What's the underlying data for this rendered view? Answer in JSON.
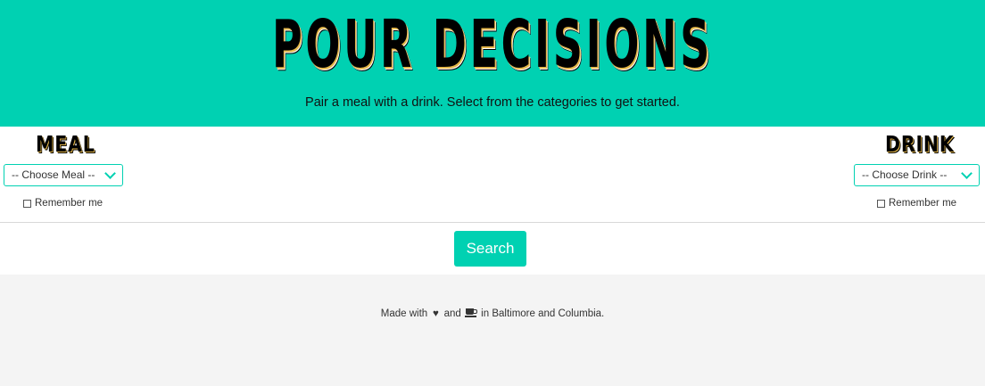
{
  "header": {
    "logo_text": "POUR DECISIONS",
    "tagline": "Pair a meal with a drink. Select from the categories to get started."
  },
  "meal": {
    "title": "MEAL",
    "select_value": "-- Choose Meal --",
    "remember_label": "Remember me",
    "remember_checked": false
  },
  "drink": {
    "title": "DRINK",
    "select_value": "-- Choose Drink --",
    "remember_label": "Remember me",
    "remember_checked": false
  },
  "search": {
    "label": "Search"
  },
  "footer": {
    "made_with": "Made with",
    "and": "and",
    "location": "in Baltimore and Columbia.",
    "icons": [
      "heart-icon",
      "coffee-icon"
    ]
  },
  "colors": {
    "accent": "#00d1b2",
    "footer_bg": "#f4f4f4",
    "logo_shadow": "#e6b84b"
  }
}
